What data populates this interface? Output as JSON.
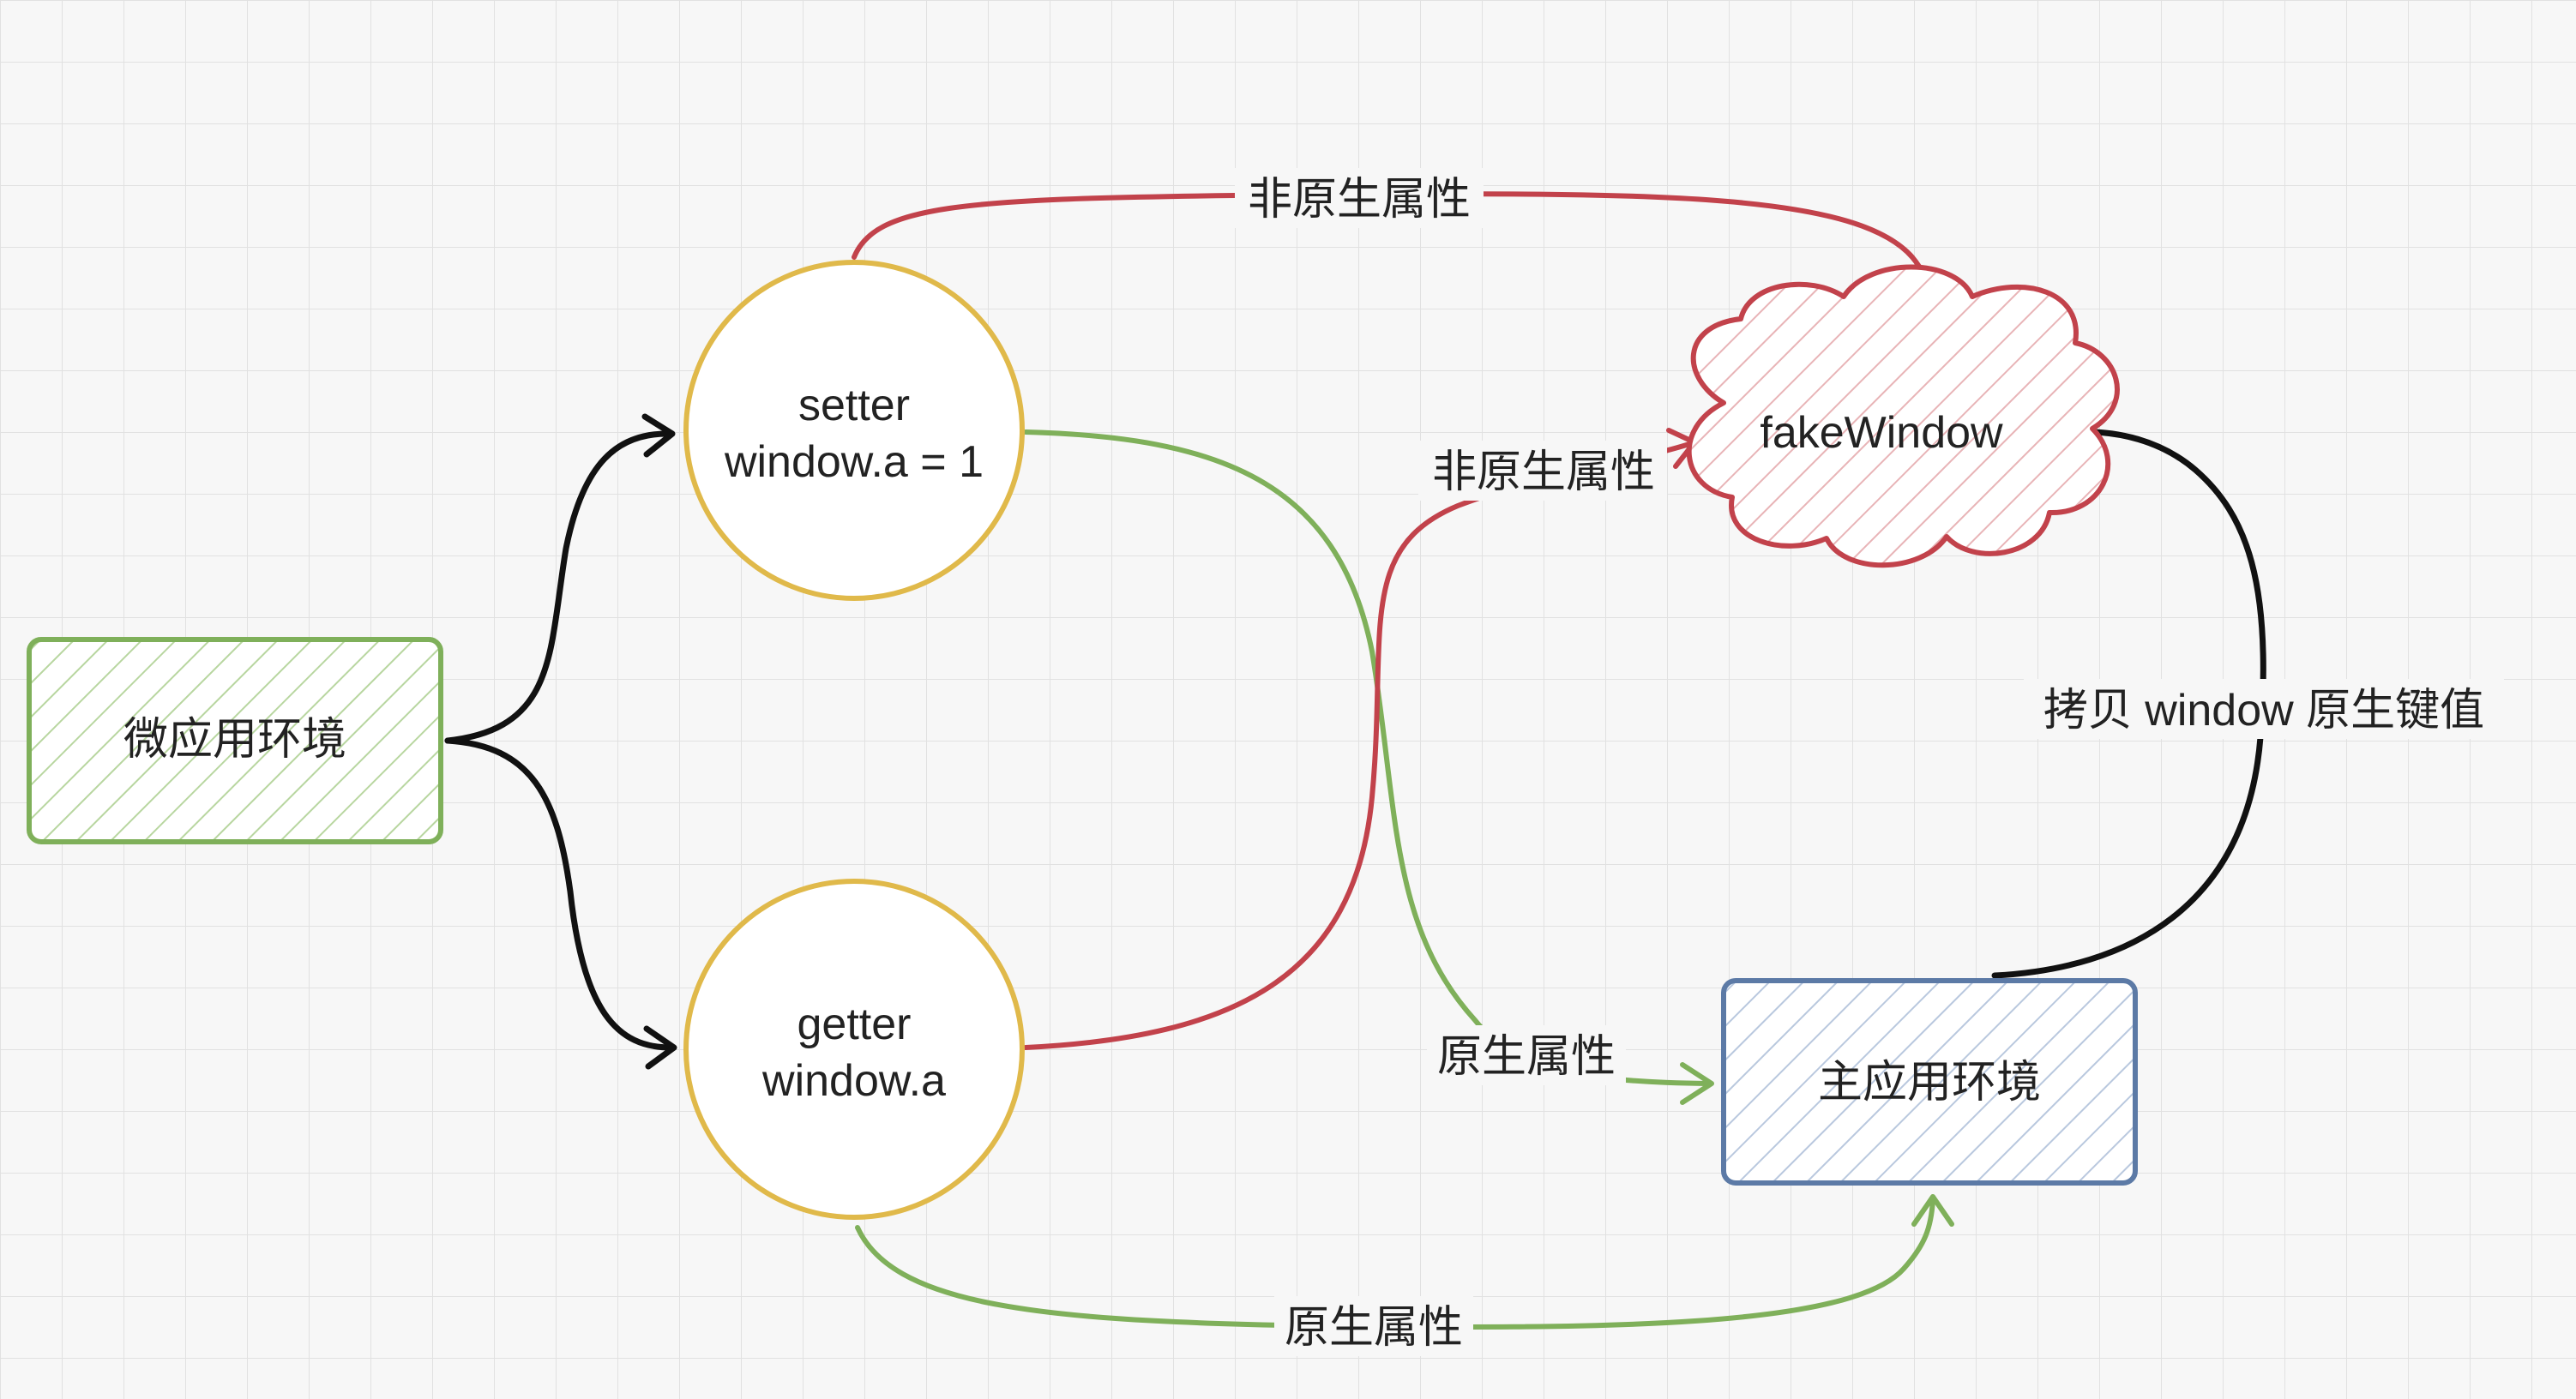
{
  "colors": {
    "background": "#f7f7f7",
    "grid": "#e1e1e1",
    "black_arrow": "#111111",
    "red": "#c2424b",
    "green": "#7fb05a",
    "yellow": "#e0b94a",
    "blue": "#5c7aa6"
  },
  "nodes": {
    "micro_app": {
      "label": "微应用环境"
    },
    "setter": {
      "line1": "setter",
      "line2": "window.a = 1"
    },
    "getter": {
      "line1": "getter",
      "line2": "window.a"
    },
    "fake_window": {
      "label": "fakeWindow"
    },
    "main_app": {
      "label": "主应用环境"
    }
  },
  "edges": {
    "setter_to_fake": {
      "label": "非原生属性"
    },
    "getter_to_fake": {
      "label": "非原生属性"
    },
    "setter_to_main": {
      "label": "原生属性"
    },
    "getter_to_main": {
      "label": "原生属性"
    },
    "main_to_fake": {
      "label": "拷贝 window 原生键值"
    }
  }
}
